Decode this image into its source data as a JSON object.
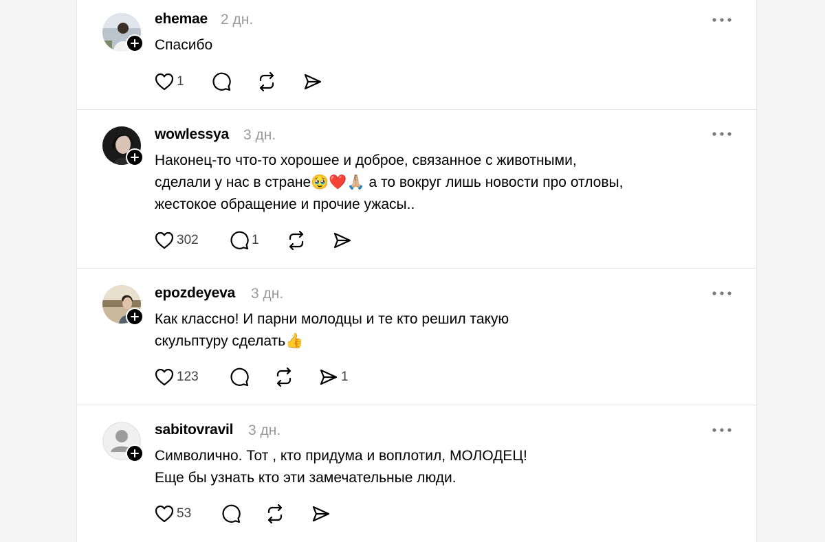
{
  "posts": [
    {
      "username": "ehemae",
      "time": "2 дн.",
      "text_lines": [
        "Спасибо"
      ],
      "likes": "1",
      "replies": "",
      "reposts": "",
      "shares": ""
    },
    {
      "username": "wowlessya",
      "time": "3 дн.",
      "text_lines": [
        "Наконец-то что-то хорошее и доброе, связанное с животными,",
        "сделали у нас в стране🥹❤️🙏🏼 а то вокруг лишь новости про отловы,",
        "жестокое обращение и прочие ужасы.."
      ],
      "likes": "302",
      "replies": "1",
      "reposts": "",
      "shares": ""
    },
    {
      "username": "epozdeyeva",
      "time": "3 дн.",
      "text_lines": [
        "Как классно! И парни молодцы и те кто решил такую",
        "скульптуру сделать👍"
      ],
      "likes": "123",
      "replies": "",
      "reposts": "",
      "shares": "1"
    },
    {
      "username": "sabitovravil",
      "time": "3 дн.",
      "text_lines": [
        "Символично. Тот , кто придума и воплотил, МОЛОДЕЦ!",
        "Еще бы узнать кто эти замечательные люди."
      ],
      "likes": "53",
      "replies": "",
      "reposts": "",
      "shares": ""
    }
  ],
  "icons": {
    "like": "heart-icon",
    "reply": "comment-icon",
    "repost": "repost-icon",
    "share": "send-icon",
    "more": "more-horizontal-icon",
    "follow": "plus-icon"
  },
  "colors": {
    "text": "#000000",
    "muted": "#999999",
    "icon": "#000000",
    "divider": "#e5e5e5"
  }
}
